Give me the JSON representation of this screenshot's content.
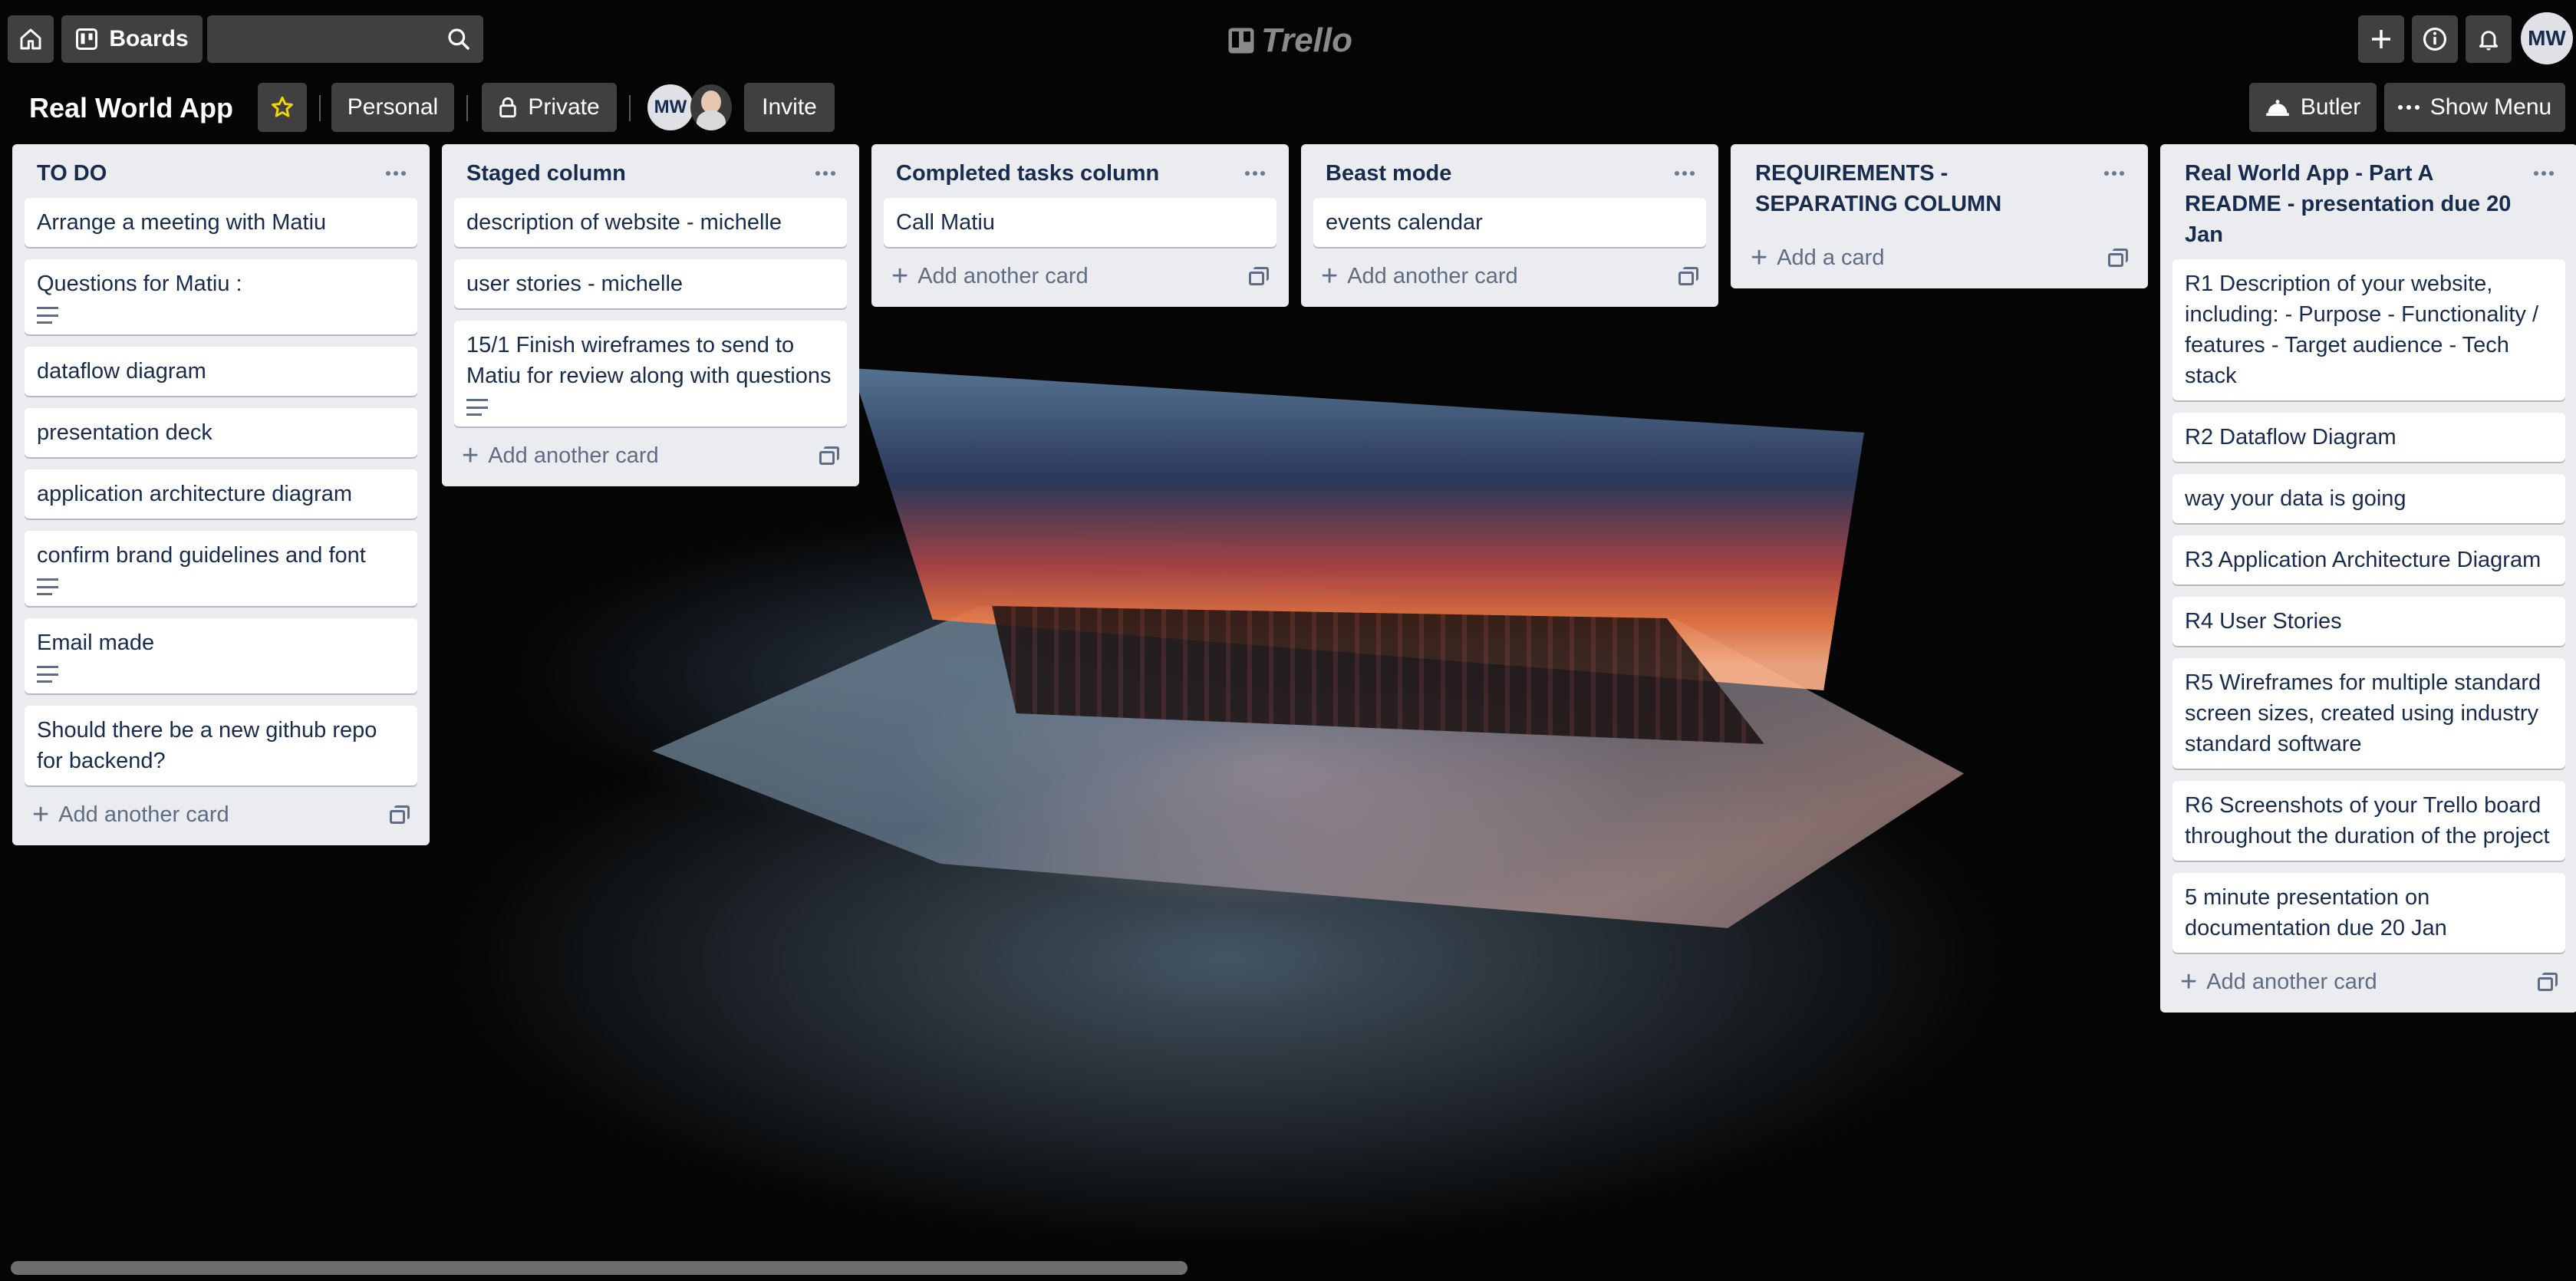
{
  "topbar": {
    "home_icon": "home-icon",
    "boards_label": "Boards",
    "search_placeholder": "",
    "logo_text": "Trello",
    "user_initials": "MW"
  },
  "board": {
    "title": "Real World App",
    "visibility_team": "Personal",
    "visibility": "Private",
    "member_initials": "MW",
    "invite_label": "Invite",
    "butler_label": "Butler",
    "show_menu_label": "Show Menu"
  },
  "lists": [
    {
      "title": "TO DO",
      "cards": [
        {
          "text": "Arrange a meeting with Matiu",
          "has_description": false
        },
        {
          "text": "Questions for Matiu :",
          "has_description": true
        },
        {
          "text": "dataflow diagram",
          "has_description": false
        },
        {
          "text": "presentation deck",
          "has_description": false
        },
        {
          "text": "application architecture diagram",
          "has_description": false
        },
        {
          "text": "confirm brand guidelines and font",
          "has_description": true
        },
        {
          "text": "Email made",
          "has_description": true
        },
        {
          "text": "Should there be a new github repo for backend?",
          "has_description": false
        }
      ],
      "add_label": "Add another card"
    },
    {
      "title": "Staged column",
      "cards": [
        {
          "text": "description of website - michelle",
          "has_description": false
        },
        {
          "text": "user stories - michelle",
          "has_description": false
        },
        {
          "text": "15/1 Finish wireframes to send to Matiu for review along with questions",
          "has_description": true
        }
      ],
      "add_label": "Add another card"
    },
    {
      "title": "Completed tasks column",
      "cards": [
        {
          "text": "Call Matiu",
          "has_description": false
        }
      ],
      "add_label": "Add another card"
    },
    {
      "title": "Beast mode",
      "cards": [
        {
          "text": "events calendar",
          "has_description": false
        }
      ],
      "add_label": "Add another card"
    },
    {
      "title": "REQUIREMENTS - SEPARATING COLUMN",
      "cards": [],
      "add_label": "Add a card"
    },
    {
      "title": "Real World App - Part A README - presentation due 20 Jan",
      "cards": [
        {
          "text": "R1 Description of your website, including: - Purpose - Functionality / features - Target audience - Tech stack",
          "has_description": false
        },
        {
          "text": "R2 Dataflow Diagram",
          "has_description": false
        },
        {
          "text": "way your data is going",
          "has_description": false
        },
        {
          "text": "R3 Application Architecture Diagram",
          "has_description": false
        },
        {
          "text": "R4 User Stories",
          "has_description": false
        },
        {
          "text": "R5 Wireframes for multiple standard screen sizes, created using industry standard software",
          "has_description": false
        },
        {
          "text": "R6 Screenshots of your Trello board throughout the duration of the project",
          "has_description": false
        },
        {
          "text": "5 minute presentation on documentation due 20 Jan",
          "has_description": false
        }
      ],
      "add_label": "Add another card"
    }
  ],
  "colors": {
    "list_bg": "#ebecf0",
    "card_bg": "#ffffff",
    "text": "#172b4d",
    "muted": "#5e6c84",
    "star": "#f2d600"
  }
}
